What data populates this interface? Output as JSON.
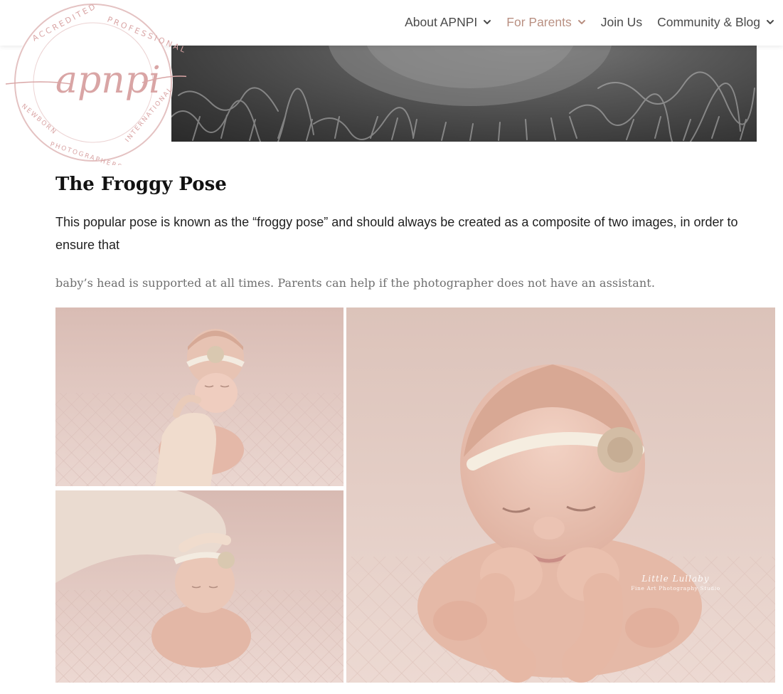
{
  "nav": {
    "items": [
      {
        "label": "About APNPI",
        "has_dropdown": true,
        "active": false
      },
      {
        "label": "For Parents",
        "has_dropdown": true,
        "active": true
      },
      {
        "label": "Join Us",
        "has_dropdown": false,
        "active": false
      },
      {
        "label": "Community & Blog",
        "has_dropdown": true,
        "active": false
      }
    ],
    "active_color": "#b99082",
    "text_color": "#4a4a4a"
  },
  "logo": {
    "wordmark": "apnpi",
    "ring_top": "ACCREDITED PROFESSIONAL",
    "ring_bottom": "NEWBORN PHOTOGRAPHERS INTERNATIONAL",
    "color": "#d6a8a8"
  },
  "article": {
    "title": "The Froggy Pose",
    "lead": "This popular pose is known as the “froggy pose” and should always be created as a composite of two images, in order to ensure that",
    "subtext": "baby’s head is supported at all times.  Parents can help if the photographer does not have an assistant."
  },
  "gallery": {
    "images": [
      {
        "name": "froggy-pose-chin-supported-photo"
      },
      {
        "name": "froggy-pose-head-supported-photo"
      },
      {
        "name": "froggy-pose-final-composite-photo"
      }
    ],
    "watermark_line1": "Little Lullaby",
    "watermark_line2": "Fine Art Photography Studio"
  }
}
